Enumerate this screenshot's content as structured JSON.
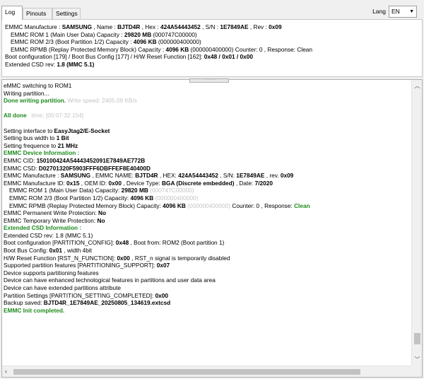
{
  "tabs": [
    "Log",
    "Pinouts",
    "Settings"
  ],
  "lang": {
    "label": "Lang",
    "value": "EN"
  },
  "summary": {
    "l1_a": "EMMC Manufacture : ",
    "l1_mfr": "SAMSUNG",
    "l1_b": " , Name : ",
    "l1_name": "BJTD4R",
    "l1_c": " , Hex : ",
    "l1_hex": "424A54443452",
    "l1_d": " , S/N : ",
    "l1_sn": "1E7849AE",
    "l1_e": " , Rev : ",
    "l1_rev": "0x09",
    "l2_a": "EMMC ROM 1 (Main User Data) Capacity : ",
    "l2_b": "29820 MB",
    "l2_c": " (000747C00000)",
    "l3_a": "EMMC ROM 2/3 (Boot Partition 1/2) Capacity : ",
    "l3_b": "4096 KB",
    "l3_c": " (000000400000)",
    "l4_a": "EMMC RPMB (Replay Protected Memory Block) Capacity : ",
    "l4_b": "4096 KB",
    "l4_c": " (000000400000) Counter: 0 , Response: Clean",
    "l5_a": "Boot configuration [179] / Boot Bus Config [177] / H/W Reset Function [162]: ",
    "l5_b": "0x48 / 0x01 / 0x00",
    "l6_a": "Extended CSD rev: ",
    "l6_b": "1.8 (MMC 5.1)"
  },
  "log": {
    "l01": "eMMC switching to ROM1",
    "l02": "Writing partition...",
    "l03_a": "Done writing partition.",
    "l03_b": " Write speed: 2405.09 KB/s",
    "l05_a": "All done",
    "l05_b": "time: [00:07:32:154]",
    "l07_a": "Setting interface to ",
    "l07_b": "EasyJtag2/E-Socket",
    "l08_a": "Setting bus width to ",
    "l08_b": "1 Bit",
    "l09_a": "Setting frequence to ",
    "l09_b": "21 MHz",
    "l10": "EMMC Device Information :",
    "l11_a": "EMMC CID: ",
    "l11_b": "150100424A54443452091E7849AE772B",
    "l12_a": "EMMC CSD: ",
    "l12_b": "D02701320F5903FFF6DBFFEF8E40400D",
    "l13_a": "EMMC Manufacture : ",
    "l13_b": "SAMSUNG",
    "l13_c": " , EMMC NAME: ",
    "l13_d": "BJTD4R",
    "l13_e": " , HEX: ",
    "l13_f": "424A54443452",
    "l13_g": " , S/N: ",
    "l13_h": "1E7849AE",
    "l13_i": " , rev. ",
    "l13_j": "0x09",
    "l14_a": "EMMC Manufacture ID: ",
    "l14_b": "0x15",
    "l14_c": " , OEM ID: ",
    "l14_d": "0x00",
    "l14_e": " , Device Type: ",
    "l14_f": "BGA (Discrete embedded)",
    "l14_g": " , Date: ",
    "l14_h": "7/2020",
    "l15_a": "EMMC ROM 1 (Main User Data) Capacity: ",
    "l15_b": "29820 MB",
    "l15_c": " (000747C00000)",
    "l16_a": "EMMC ROM 2/3 (Boot Partition 1/2) Capacity: ",
    "l16_b": "4096 KB",
    "l16_c": " (000000400000)",
    "l17_a": "EMMC RPMB (Replay Protected Memory Block) Capacity: ",
    "l17_b": "4096 KB",
    "l17_c": " (000000400000)",
    "l17_d": "  Counter: 0 , Response: ",
    "l17_e": "Clean",
    "l18_a": "EMMC Permanent Write Protection: ",
    "l18_b": "No",
    "l19_a": "EMMC Temporary Write Protection: ",
    "l19_b": "No",
    "l20": "Extended CSD Information :",
    "l21": "Extended CSD rev: 1.8 (MMC 5.1)",
    "l22_a": "Boot configuration [PARTITION_CONFIG]: ",
    "l22_b": "0x48",
    "l22_c": " , Boot from: ROM2 (Boot partition 1)",
    "l23_a": "Boot Bus Config: ",
    "l23_b": "0x01",
    "l23_c": " , width 4bit",
    "l24_a": "H/W Reset Function [RST_N_FUNCTION]: ",
    "l24_b": "0x00",
    "l24_c": " , RST_n signal is temporarily disabled",
    "l25_a": "Supported partition features [PARTITIONING_SUPPORT]: ",
    "l25_b": "0x07",
    "l26": "Device supports partitioning features",
    "l27": "Device can have enhanced technological features in partitions and user data area",
    "l28": "Device can have extended partitions attribute",
    "l29_a": "Partition Settings [PARTITION_SETTING_COMPLETED]: ",
    "l29_b": "0x00",
    "l30_a": "Backup saved: ",
    "l30_b": "BJTD4R_1E7849AE_20250805_134619.extcsd",
    "l31": "EMMC Init completed."
  },
  "icons": {
    "scroll_up": "chevron-up-icon",
    "scroll_down": "chevron-down-icon",
    "scroll_left": "chevron-left-icon",
    "scroll_right": "chevron-right-icon",
    "dropdown": "chevron-down-icon",
    "splitter": "grip-dots-icon"
  },
  "colors": {
    "success_green": "#1e8b1e",
    "timestamp_gray": "#9a9a9a"
  }
}
